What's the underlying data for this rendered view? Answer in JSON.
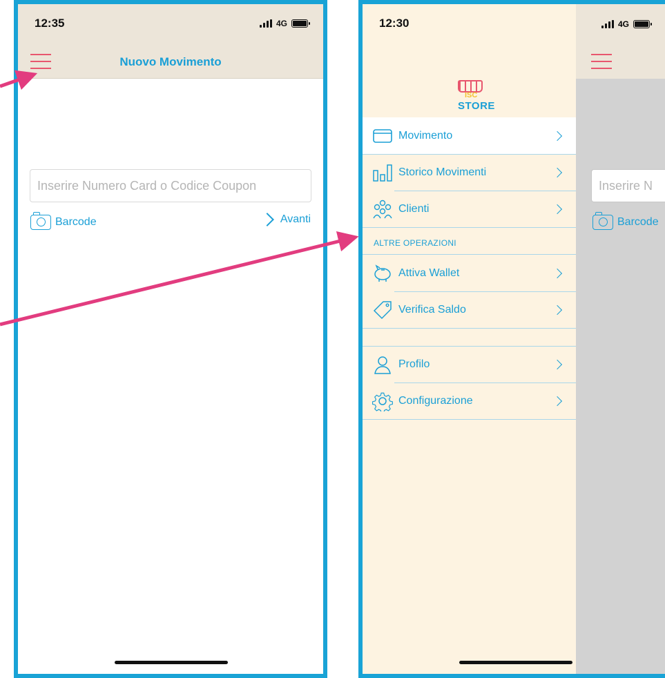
{
  "left_screen": {
    "status": {
      "time": "12:35",
      "network": "4G"
    },
    "title": "Nuovo Movimento",
    "input_placeholder": "Inserire Numero Card o Codice Coupon",
    "barcode_label": "Barcode",
    "next_label": "Avanti"
  },
  "right_screen": {
    "status": {
      "time": "12:30",
      "network": "4G"
    },
    "logo": {
      "line1": "ISC",
      "line2": "STORE"
    },
    "menu": {
      "items": [
        {
          "label": "Movimento",
          "icon": "card-icon"
        },
        {
          "label": "Storico Movimenti",
          "icon": "chart-icon"
        },
        {
          "label": "Clienti",
          "icon": "people-icon"
        }
      ],
      "section_title": "ALTRE OPERAZIONI",
      "other_items": [
        {
          "label": "Attiva Wallet",
          "icon": "piggy-bank-icon"
        },
        {
          "label": "Verifica Saldo",
          "icon": "tag-icon"
        }
      ],
      "bottom_items": [
        {
          "label": "Profilo",
          "icon": "user-icon"
        },
        {
          "label": "Configurazione",
          "icon": "gear-icon"
        }
      ]
    },
    "background_input_placeholder": "Inserire N",
    "background_barcode_label": "Barcode"
  },
  "colors": {
    "accent": "#1a9fd6",
    "menu_icon": "#e8566e",
    "annotation_arrow": "#e23c7f",
    "frame": "#19a3d6",
    "drawer_bg": "#fdf3e1"
  }
}
